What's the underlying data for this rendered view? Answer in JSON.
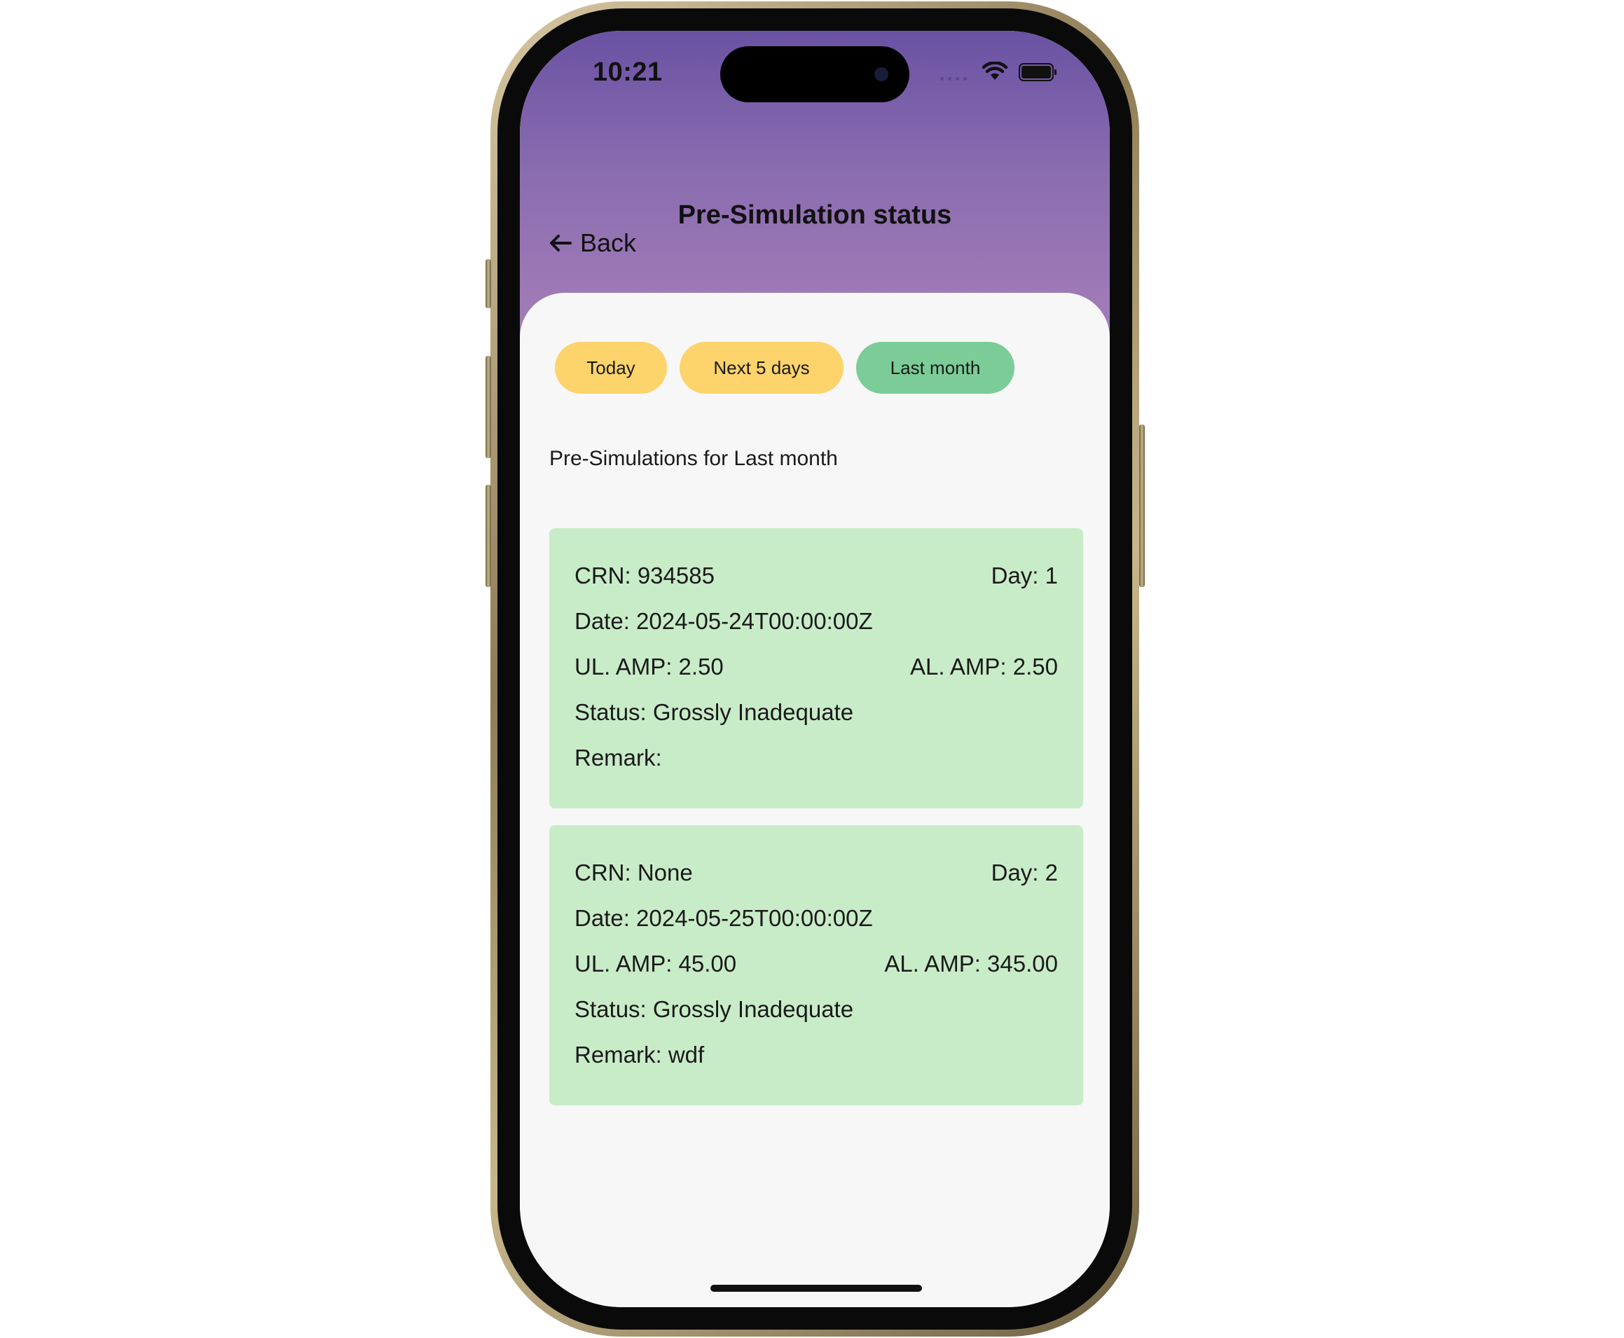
{
  "status_bar": {
    "time": "10:21"
  },
  "header": {
    "title": "Pre-Simulation status",
    "back_label": "Back"
  },
  "filters": [
    {
      "label": "Today",
      "color": "#fdd36b"
    },
    {
      "label": "Next 5 days",
      "color": "#fdd36b"
    },
    {
      "label": "Last month",
      "color": "#7bcc97",
      "selected": true
    }
  ],
  "section_label": "Pre-Simulations for Last month",
  "records": [
    {
      "crn": "CRN: 934585",
      "day": "Day: 1",
      "date": "Date: 2024-05-24T00:00:00Z",
      "ul_amp": "UL. AMP: 2.50",
      "al_amp": "AL. AMP: 2.50",
      "status": "Status: Grossly Inadequate",
      "remark": "Remark:"
    },
    {
      "crn": "CRN: None",
      "day": "Day: 2",
      "date": "Date: 2024-05-25T00:00:00Z",
      "ul_amp": "UL. AMP: 45.00",
      "al_amp": "AL. AMP: 345.00",
      "status": "Status: Grossly Inadequate",
      "remark": "Remark: wdf"
    }
  ],
  "colors": {
    "header_gradient_top": "#6a52a3",
    "header_gradient_bottom": "#a77fb9",
    "card_background": "#c9ecc8",
    "chip_inactive": "#fdd36b",
    "chip_active": "#7bcc97"
  },
  "icons": {
    "back": "arrow-left-icon",
    "wifi": "wifi-icon",
    "battery": "battery-icon"
  }
}
